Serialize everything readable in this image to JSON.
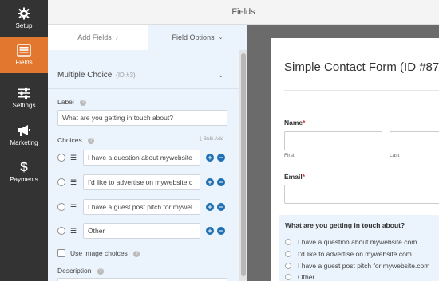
{
  "nav": {
    "items": [
      {
        "label": "Setup",
        "icon": "gear-icon"
      },
      {
        "label": "Fields",
        "icon": "fields-list-icon",
        "active": true
      },
      {
        "label": "Settings",
        "icon": "sliders-icon"
      },
      {
        "label": "Marketing",
        "icon": "megaphone-icon"
      },
      {
        "label": "Payments",
        "icon": "dollar-icon"
      }
    ],
    "active_color": "#e27730",
    "bg_color": "#333333"
  },
  "header": {
    "title": "Fields"
  },
  "tabs": {
    "add_fields": "Add Fields",
    "field_options": "Field Options"
  },
  "field_options": {
    "field_type": "Multiple Choice",
    "field_id": "(ID #3)",
    "label_heading": "Label",
    "label_value": "What are you getting in touch about?",
    "choices_heading": "Choices",
    "bulk_add": "Bulk Add",
    "choices": [
      "I have a question about mywebsite",
      "I'd like to advertise on mywebsite.c",
      "I have a guest post pitch for mywel",
      "Other"
    ],
    "image_choices_label": "Use image choices",
    "description_heading": "Description"
  },
  "preview": {
    "form_title": "Simple Contact Form (ID #87",
    "name_label": "Name",
    "first_label": "First",
    "last_label": "Last",
    "email_label": "Email",
    "required_marker": "*",
    "mc_label": "What are you getting in touch about?",
    "mc_choices": [
      "I have a question about mywebsite.com",
      "I'd like to advertise on mywebsite.com",
      "I have a guest post pitch for mywebsite.com",
      "Other"
    ]
  },
  "colors": {
    "accent_blue": "#1f6fb2",
    "panel_bg": "#ebf3fc",
    "required": "#d63638"
  }
}
